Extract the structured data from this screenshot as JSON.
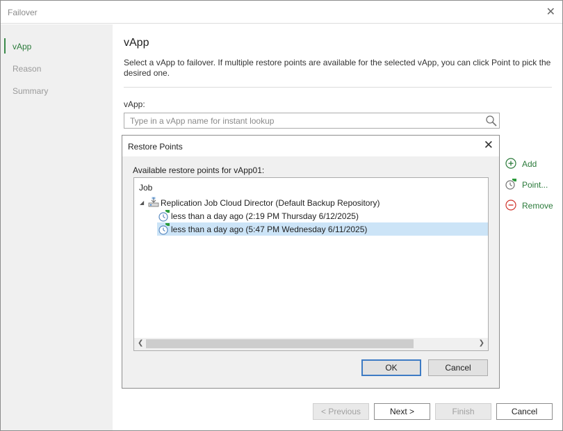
{
  "window": {
    "title": "Failover",
    "close_glyph": "✕"
  },
  "sidebar": {
    "steps": [
      {
        "label": "vApp",
        "active": true
      },
      {
        "label": "Reason",
        "active": false
      },
      {
        "label": "Summary",
        "active": false
      }
    ]
  },
  "main": {
    "title": "vApp",
    "description": "Select a vApp to failover. If multiple restore points are available for the selected vApp, you can click Point to pick the desired one.",
    "field_label": "vApp:",
    "search_placeholder": "Type in a vApp name for instant lookup"
  },
  "actions": {
    "add": "Add",
    "point": "Point...",
    "remove": "Remove"
  },
  "dialog": {
    "title": "Restore Points",
    "available_label": "Available restore points for vApp01:",
    "column_header": "Job",
    "job": "Replication Job Cloud Director (Default Backup Repository)",
    "points": [
      "less than a day ago (2:19 PM Thursday 6/12/2025)",
      "less than a day ago (5:47 PM Wednesday 6/11/2025)"
    ],
    "selected_point_index": 1,
    "ok": "OK",
    "cancel": "Cancel"
  },
  "footer": {
    "previous": "< Previous",
    "next": "Next >",
    "finish": "Finish",
    "cancel": "Cancel"
  },
  "colors": {
    "accent_green": "#2a7a3a",
    "selection": "#cce4f7",
    "focus_blue": "#3d7bc4",
    "remove_red": "#d0342c"
  }
}
